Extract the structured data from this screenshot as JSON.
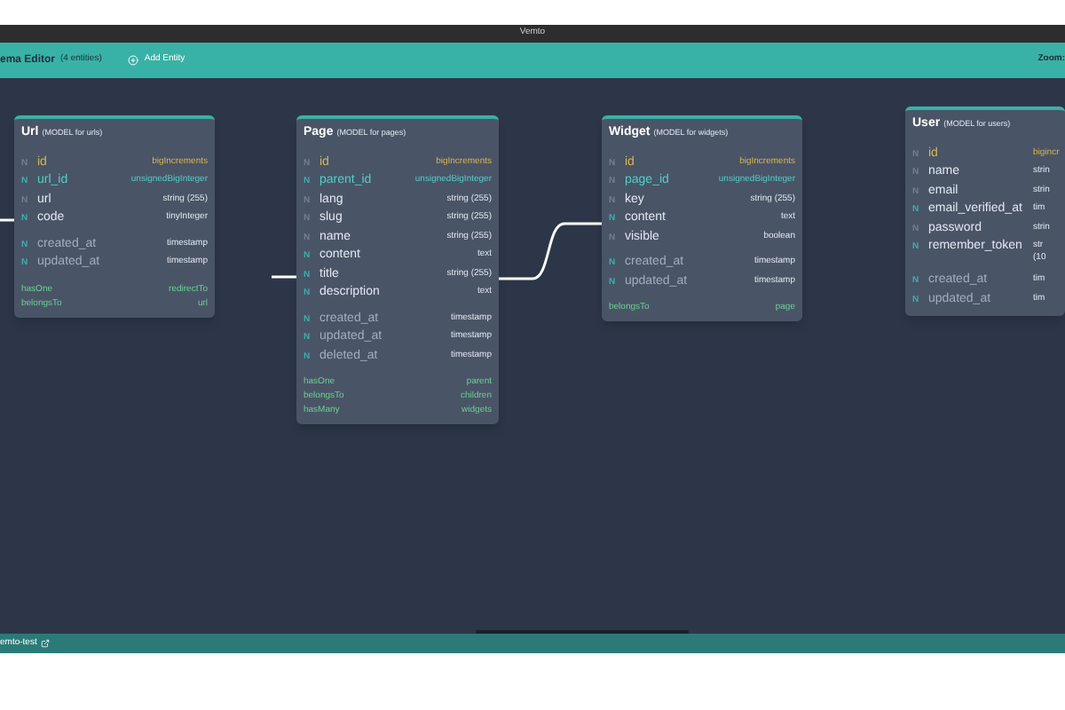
{
  "window": {
    "title": "Vemto"
  },
  "toolbar": {
    "title": "ema Editor",
    "count": "(4 entities)",
    "add_button": "Add Entity",
    "zoom_label": "Zoom:"
  },
  "entities": [
    {
      "name": "Url",
      "subtitle": "(MODEL for urls)",
      "fields": [
        {
          "marker": "N",
          "name": "id",
          "type": "bigIncrements",
          "kind": "primary",
          "nullable": false
        },
        {
          "marker": "N",
          "name": "url_id",
          "type": "unsignedBigInteger",
          "kind": "foreign",
          "nullable": true
        },
        {
          "marker": "N",
          "name": "url",
          "type": "string (255)",
          "kind": "normal",
          "nullable": false
        },
        {
          "marker": "N",
          "name": "code",
          "type": "tinyInteger",
          "kind": "normal",
          "nullable": true
        },
        {
          "marker": "N",
          "name": "created_at",
          "type": "timestamp",
          "kind": "timestamp",
          "nullable": true
        },
        {
          "marker": "N",
          "name": "updated_at",
          "type": "timestamp",
          "kind": "timestamp",
          "nullable": true
        }
      ],
      "relations": [
        {
          "type": "hasOne",
          "target": "redirectTo"
        },
        {
          "type": "belongsTo",
          "target": "url"
        }
      ]
    },
    {
      "name": "Page",
      "subtitle": "(MODEL for pages)",
      "fields": [
        {
          "marker": "N",
          "name": "id",
          "type": "bigIncrements",
          "kind": "primary",
          "nullable": false
        },
        {
          "marker": "N",
          "name": "parent_id",
          "type": "unsignedBigInteger",
          "kind": "foreign",
          "nullable": true
        },
        {
          "marker": "N",
          "name": "lang",
          "type": "string (255)",
          "kind": "normal",
          "nullable": false
        },
        {
          "marker": "N",
          "name": "slug",
          "type": "string (255)",
          "kind": "normal",
          "nullable": false
        },
        {
          "marker": "N",
          "name": "name",
          "type": "string (255)",
          "kind": "normal",
          "nullable": false
        },
        {
          "marker": "N",
          "name": "content",
          "type": "text",
          "kind": "normal",
          "nullable": true
        },
        {
          "marker": "N",
          "name": "title",
          "type": "string (255)",
          "kind": "normal",
          "nullable": true
        },
        {
          "marker": "N",
          "name": "description",
          "type": "text",
          "kind": "normal",
          "nullable": true
        },
        {
          "marker": "N",
          "name": "created_at",
          "type": "timestamp",
          "kind": "timestamp",
          "nullable": true
        },
        {
          "marker": "N",
          "name": "updated_at",
          "type": "timestamp",
          "kind": "timestamp",
          "nullable": true
        },
        {
          "marker": "N",
          "name": "deleted_at",
          "type": "timestamp",
          "kind": "timestamp",
          "nullable": true
        }
      ],
      "relations": [
        {
          "type": "hasOne",
          "target": "parent"
        },
        {
          "type": "belongsTo",
          "target": "children"
        },
        {
          "type": "hasMany",
          "target": "widgets"
        }
      ]
    },
    {
      "name": "Widget",
      "subtitle": "(MODEL for widgets)",
      "fields": [
        {
          "marker": "N",
          "name": "id",
          "type": "bigIncrements",
          "kind": "primary",
          "nullable": false
        },
        {
          "marker": "N",
          "name": "page_id",
          "type": "unsignedBigInteger",
          "kind": "foreign",
          "nullable": false
        },
        {
          "marker": "N",
          "name": "key",
          "type": "string (255)",
          "kind": "normal",
          "nullable": false
        },
        {
          "marker": "N",
          "name": "content",
          "type": "text",
          "kind": "normal",
          "nullable": true
        },
        {
          "marker": "N",
          "name": "visible",
          "type": "boolean",
          "kind": "normal",
          "nullable": false
        },
        {
          "marker": "N",
          "name": "created_at",
          "type": "timestamp",
          "kind": "timestamp",
          "nullable": true
        },
        {
          "marker": "N",
          "name": "updated_at",
          "type": "timestamp",
          "kind": "timestamp",
          "nullable": true
        }
      ],
      "relations": [
        {
          "type": "belongsTo",
          "target": "page"
        }
      ]
    },
    {
      "name": "User",
      "subtitle": "(MODEL for users)",
      "fields": [
        {
          "marker": "N",
          "name": "id",
          "type": "bigincr",
          "kind": "primary",
          "nullable": false
        },
        {
          "marker": "N",
          "name": "name",
          "type": "strin",
          "kind": "normal",
          "nullable": false
        },
        {
          "marker": "N",
          "name": "email",
          "type": "strin",
          "kind": "normal",
          "nullable": false
        },
        {
          "marker": "N",
          "name": "email_verified_at",
          "type": "tim",
          "kind": "normal",
          "nullable": true
        },
        {
          "marker": "N",
          "name": "password",
          "type": "strin",
          "kind": "normal",
          "nullable": false
        },
        {
          "marker": "N",
          "name": "remember_token",
          "type": "str (10",
          "kind": "normal",
          "nullable": true
        },
        {
          "marker": "N",
          "name": "created_at",
          "type": "tim",
          "kind": "timestamp",
          "nullable": true
        },
        {
          "marker": "N",
          "name": "updated_at",
          "type": "tim",
          "kind": "timestamp",
          "nullable": true
        }
      ]
    }
  ],
  "status_bar": {
    "project": "emto-test"
  }
}
